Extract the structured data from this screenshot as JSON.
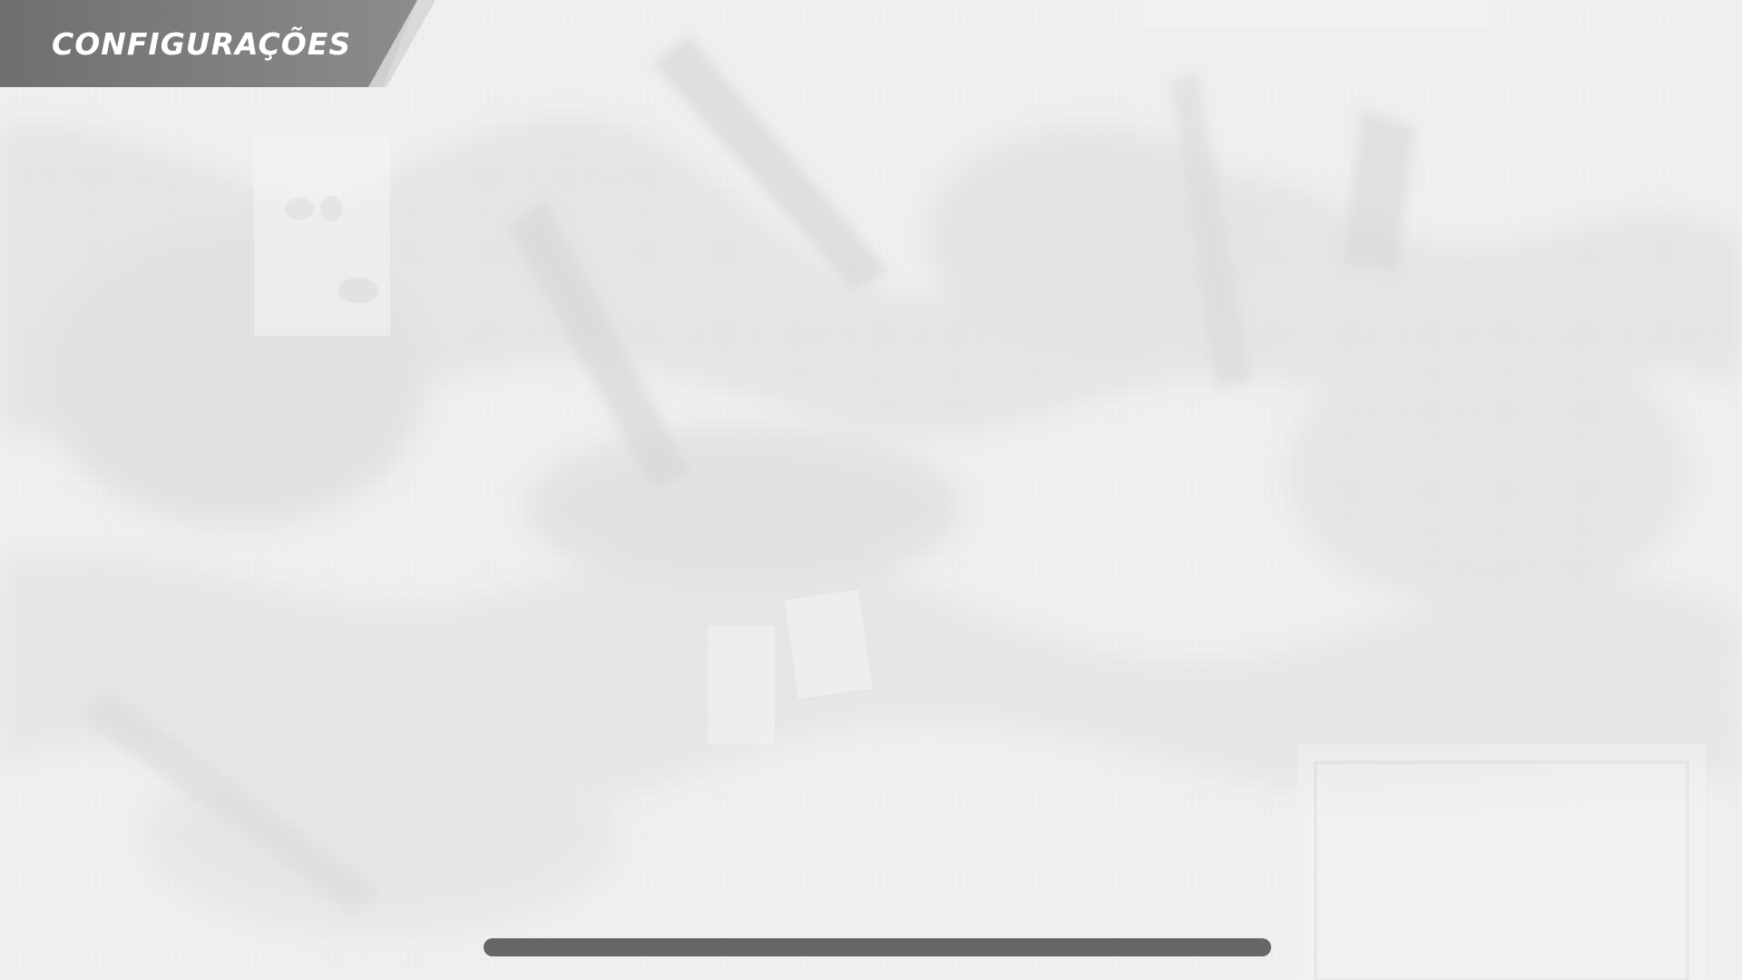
{
  "header": {
    "title": "CONFIGURAÇÕES"
  },
  "colors": {
    "background": "#eeeeee",
    "header_fill": "#7a7a7a",
    "header_accent": "#d6d6d6",
    "title_text": "#ffffff",
    "home_indicator": "#666666"
  },
  "icons": {
    "background": "grunge-collage-texture"
  }
}
